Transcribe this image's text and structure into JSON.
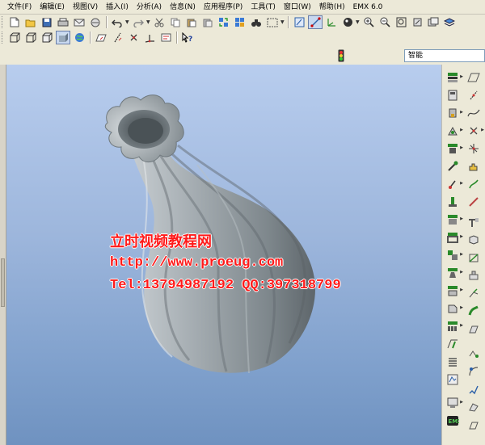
{
  "menubar": {
    "items": [
      {
        "label": "文件",
        "key": "(F)"
      },
      {
        "label": "编辑",
        "key": "(E)"
      },
      {
        "label": "视图",
        "key": "(V)"
      },
      {
        "label": "插入",
        "key": "(I)"
      },
      {
        "label": "分析",
        "key": "(A)"
      },
      {
        "label": "信息",
        "key": "(N)"
      },
      {
        "label": "应用程序",
        "key": "(P)"
      },
      {
        "label": "工具",
        "key": "(T)"
      },
      {
        "label": "窗口",
        "key": "(W)"
      },
      {
        "label": "帮助",
        "key": "(H)"
      },
      {
        "label": "EMX 6.0",
        "key": ""
      }
    ]
  },
  "filter": {
    "value": "智能"
  },
  "watermark": {
    "line1": "立时视频教程网",
    "line2": "http://www.proeug.com",
    "line3": "Tel:13794987192  QQ:397318799"
  },
  "colors": {
    "canvas_top": "#b8cdee",
    "canvas_bottom": "#6f92c0",
    "model": "#8f979c",
    "watermark": "#ff1a1a",
    "toolbar_bg": "#ece9d8"
  }
}
